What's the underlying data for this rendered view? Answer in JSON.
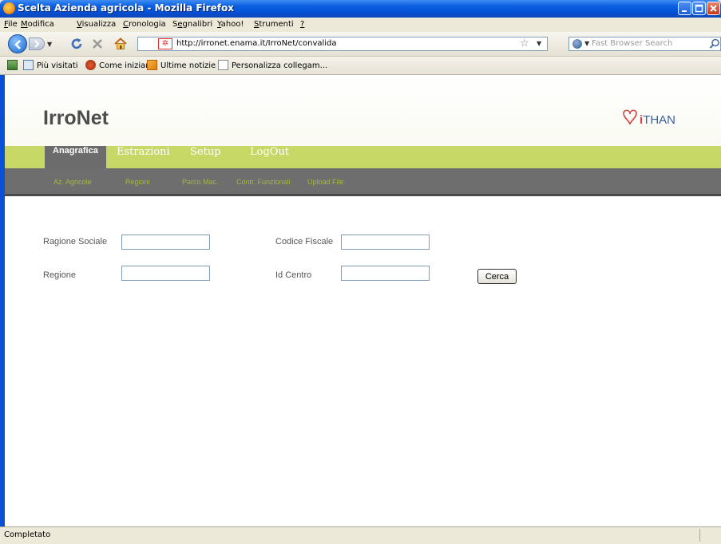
{
  "window": {
    "title": "Scelta Azienda agricola - Mozilla Firefox"
  },
  "menubar": {
    "items": [
      {
        "accel": "F",
        "rest": "ile"
      },
      {
        "accel": "M",
        "rest": "odifica"
      },
      {
        "accel": "V",
        "rest": "isualizza"
      },
      {
        "accel": "C",
        "rest": "ronologia"
      },
      {
        "pre": "S",
        "accel": "e",
        "rest": "gnalibri"
      },
      {
        "accel": "Y",
        "rest": "ahoo!"
      },
      {
        "accel": "S",
        "rest": "trumenti"
      },
      {
        "accel": "?",
        "rest": ""
      }
    ]
  },
  "navbar": {
    "url": "http://irronet.enama.it/IrroNet/convalida",
    "search_placeholder": "Fast Browser Search"
  },
  "bookmarks": [
    "Più visitati",
    "Come iniziare",
    "Ultime notizie",
    "Personalizza collegam..."
  ],
  "site": {
    "brand": "IrroNet",
    "partner_mark": "i",
    "partner_rest": "THAN"
  },
  "mainnav": [
    {
      "label": "Anagrafica",
      "active": true
    },
    {
      "label": "Estrazioni",
      "active": false
    },
    {
      "label": "Setup",
      "active": false
    },
    {
      "label": "LogOut",
      "active": false
    }
  ],
  "subnav": [
    "Az. Agricole",
    "Regioni",
    "Parco Mac.",
    "Contr. Funzionali",
    "Upload File"
  ],
  "form": {
    "ragione_sociale_label": "Ragione Sociale",
    "ragione_sociale_value": "",
    "codice_fiscale_label": "Codice Fiscale",
    "codice_fiscale_value": "",
    "regione_label": "Regione",
    "regione_value": "",
    "id_centro_label": "Id Centro",
    "id_centro_value": "",
    "search_button": "Cerca"
  },
  "status": {
    "text": "Completato"
  },
  "colors": {
    "nav_green": "#c7d866",
    "subnav_gray": "#6e6e6e",
    "active_tab": "#6c6c6c",
    "sublink_green": "#a3b845",
    "brand_text": "#4d4d4d",
    "xp_blue": "#0550d6"
  }
}
